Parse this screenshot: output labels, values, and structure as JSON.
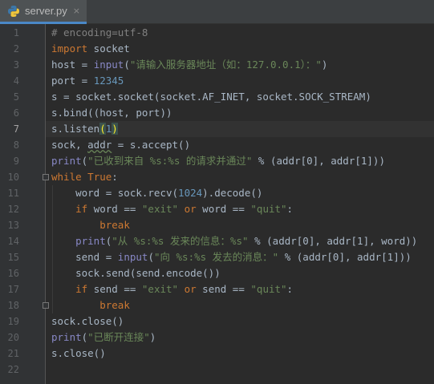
{
  "tab": {
    "filename": "server.py",
    "close_glyph": "×",
    "icon": "python-file-icon"
  },
  "colors": {
    "keyword": "#cc7832",
    "builtin": "#8888c6",
    "string": "#6a8759",
    "number": "#6897bb",
    "comment": "#808080",
    "text": "#a9b7c6"
  },
  "current_line": 7,
  "lines": [
    {
      "n": "1",
      "t": [
        [
          "cmt",
          "# encoding=utf-8"
        ]
      ]
    },
    {
      "n": "2",
      "t": [
        [
          "kw",
          "import"
        ],
        [
          "plain",
          " socket"
        ]
      ]
    },
    {
      "n": "3",
      "t": [
        [
          "plain",
          "host = "
        ],
        [
          "bi",
          "input"
        ],
        [
          "plain",
          "("
        ],
        [
          "str",
          "\"请输入服务器地址（如：127.0.0.1）：\""
        ],
        [
          "plain",
          ")"
        ]
      ]
    },
    {
      "n": "4",
      "t": [
        [
          "plain",
          "port = "
        ],
        [
          "num",
          "12345"
        ]
      ]
    },
    {
      "n": "5",
      "t": [
        [
          "plain",
          "s = socket.socket(socket.AF_INET, socket.SOCK_STREAM)"
        ]
      ]
    },
    {
      "n": "6",
      "t": [
        [
          "plain",
          "s.bind((host, port))"
        ]
      ]
    },
    {
      "n": "7",
      "t": [
        [
          "plain",
          "s.listen"
        ],
        [
          "brk",
          "("
        ],
        [
          "num",
          "1"
        ],
        [
          "brk",
          ")"
        ]
      ]
    },
    {
      "n": "8",
      "t": [
        [
          "plain",
          "sock, "
        ],
        [
          "wavy",
          "addr"
        ],
        [
          "plain",
          " = s.accept()"
        ]
      ]
    },
    {
      "n": "9",
      "t": [
        [
          "bi",
          "print"
        ],
        [
          "plain",
          "("
        ],
        [
          "str",
          "\"已收到来自 %s:%s 的请求并通过\""
        ],
        [
          "plain",
          " % (addr[0], addr[1]))"
        ]
      ]
    },
    {
      "n": "10",
      "t": [
        [
          "kw",
          "while"
        ],
        [
          "plain",
          " "
        ],
        [
          "kw",
          "True"
        ],
        [
          "plain",
          ":"
        ]
      ]
    },
    {
      "n": "11",
      "t": [
        [
          "plain",
          "    word = sock.recv("
        ],
        [
          "num",
          "1024"
        ],
        [
          "plain",
          ").decode()"
        ]
      ]
    },
    {
      "n": "12",
      "t": [
        [
          "plain",
          "    "
        ],
        [
          "kw",
          "if"
        ],
        [
          "plain",
          " word == "
        ],
        [
          "str",
          "\"exit\""
        ],
        [
          "plain",
          " "
        ],
        [
          "kw",
          "or"
        ],
        [
          "plain",
          " word == "
        ],
        [
          "str",
          "\"quit\""
        ],
        [
          "plain",
          ":"
        ]
      ]
    },
    {
      "n": "13",
      "t": [
        [
          "plain",
          "        "
        ],
        [
          "kw",
          "break"
        ]
      ]
    },
    {
      "n": "14",
      "t": [
        [
          "plain",
          "    "
        ],
        [
          "bi",
          "print"
        ],
        [
          "plain",
          "("
        ],
        [
          "str",
          "\"从 %s:%s 发来的信息：%s\""
        ],
        [
          "plain",
          " % (addr[0], addr[1], word))"
        ]
      ]
    },
    {
      "n": "15",
      "t": [
        [
          "plain",
          "    send = "
        ],
        [
          "bi",
          "input"
        ],
        [
          "plain",
          "("
        ],
        [
          "str",
          "\"向 %s:%s 发去的消息：\""
        ],
        [
          "plain",
          " % (addr[0], addr[1]))"
        ]
      ]
    },
    {
      "n": "16",
      "t": [
        [
          "plain",
          "    sock.send(send.encode())"
        ]
      ]
    },
    {
      "n": "17",
      "t": [
        [
          "plain",
          "    "
        ],
        [
          "kw",
          "if"
        ],
        [
          "plain",
          " send == "
        ],
        [
          "str",
          "\"exit\""
        ],
        [
          "plain",
          " "
        ],
        [
          "kw",
          "or"
        ],
        [
          "plain",
          " send == "
        ],
        [
          "str",
          "\"quit\""
        ],
        [
          "plain",
          ":"
        ]
      ]
    },
    {
      "n": "18",
      "t": [
        [
          "plain",
          "        "
        ],
        [
          "kw",
          "break"
        ]
      ]
    },
    {
      "n": "19",
      "t": [
        [
          "plain",
          "sock.close()"
        ]
      ]
    },
    {
      "n": "20",
      "t": [
        [
          "bi",
          "print"
        ],
        [
          "plain",
          "("
        ],
        [
          "str",
          "\"已断开连接\""
        ],
        [
          "plain",
          ")"
        ]
      ]
    },
    {
      "n": "21",
      "t": [
        [
          "plain",
          "s.close()"
        ]
      ]
    },
    {
      "n": "22",
      "t": []
    }
  ]
}
